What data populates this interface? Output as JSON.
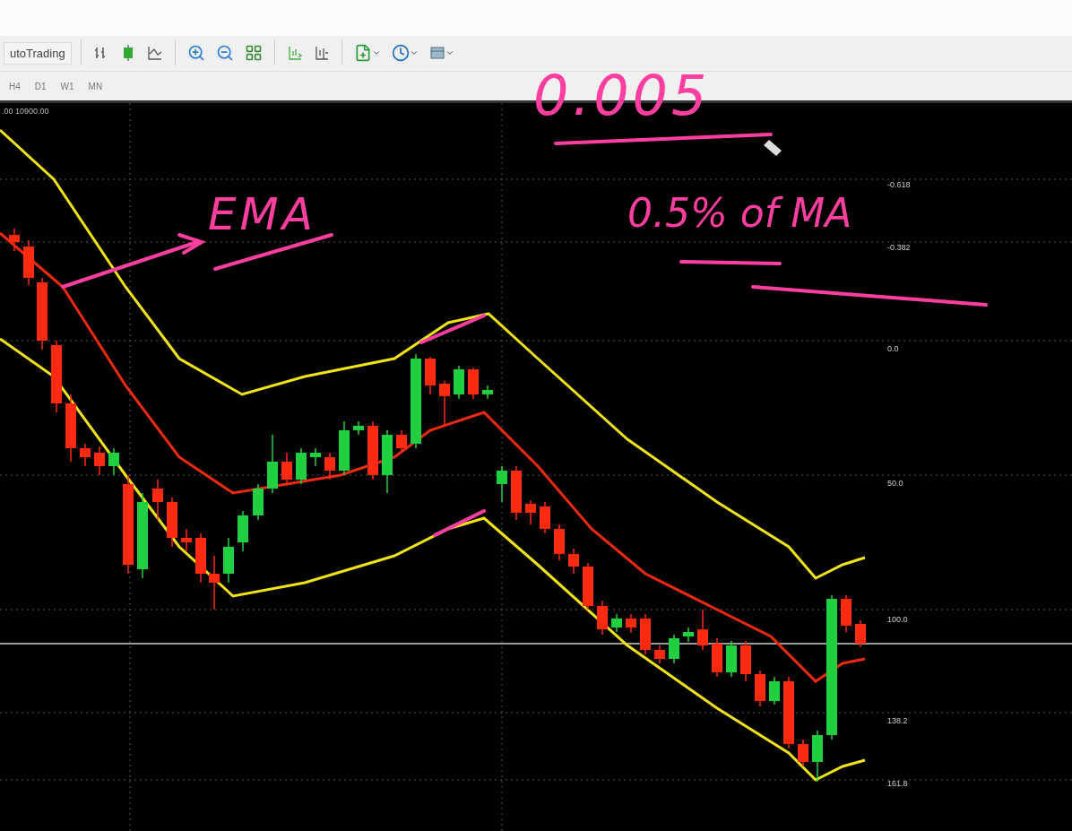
{
  "toolbar": {
    "autotrading_label": "utoTrading"
  },
  "timeframes": [
    {
      "label": "H4"
    },
    {
      "label": "D1"
    },
    {
      "label": "W1"
    },
    {
      "label": "MN"
    }
  ],
  "chart": {
    "header": ".00 10900.00",
    "levels": [
      {
        "label": "-0.618"
      },
      {
        "label": "-0.382"
      },
      {
        "label": "0.0"
      },
      {
        "label": "50.0"
      },
      {
        "label": "100.0"
      },
      {
        "label": "138.2"
      },
      {
        "label": "161.8"
      }
    ]
  },
  "annotations": [
    {
      "text": "0.005"
    },
    {
      "text": "EMA"
    },
    {
      "text": "0.5% of MA"
    }
  ]
}
